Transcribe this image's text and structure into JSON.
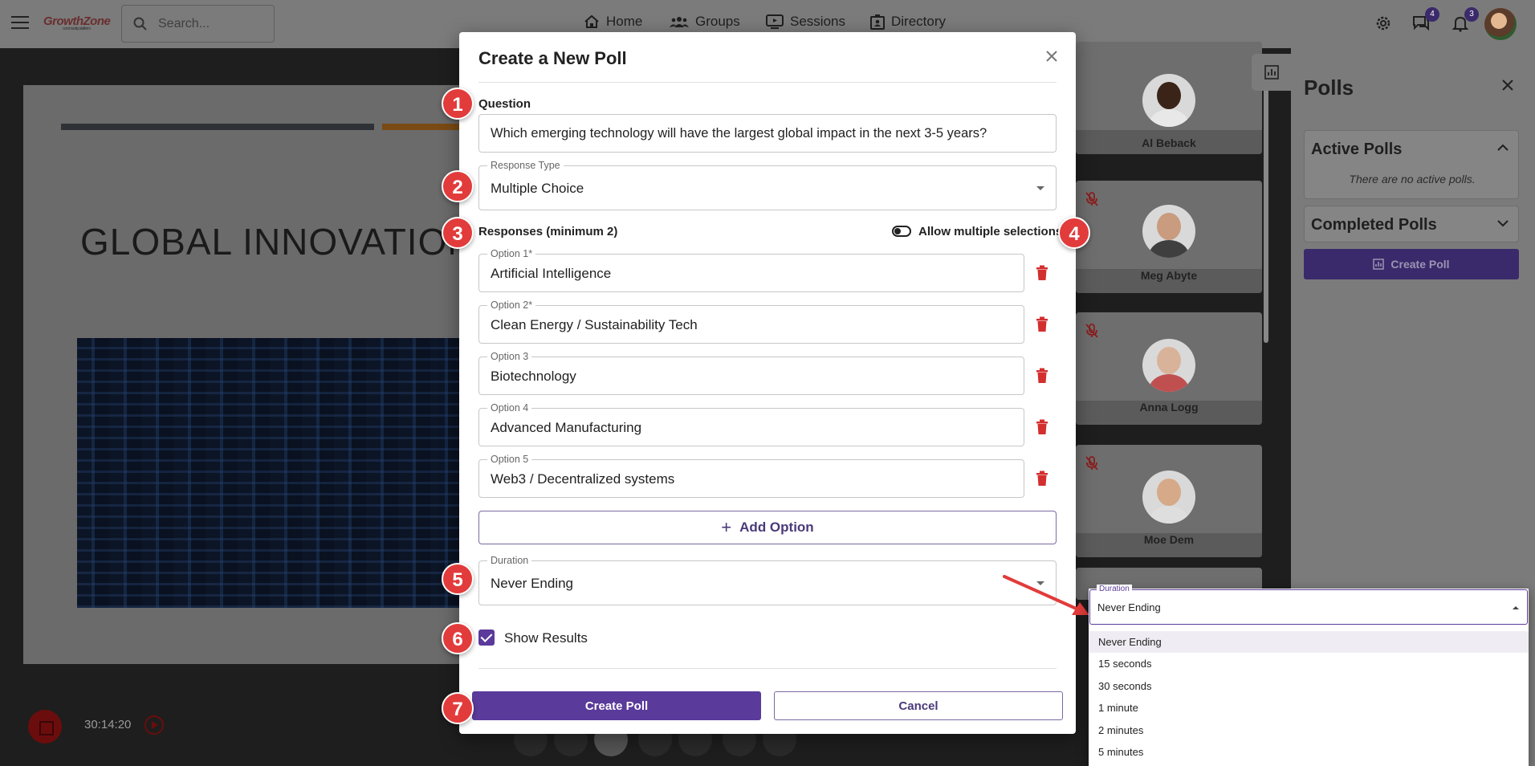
{
  "header": {
    "logo_text": "GrowthZone",
    "logo_tagline": "community platform",
    "search_placeholder": "Search...",
    "nav": [
      {
        "label": "Home"
      },
      {
        "label": "Groups"
      },
      {
        "label": "Sessions"
      },
      {
        "label": "Directory"
      }
    ],
    "chat_badge": "4",
    "notification_badge": "3"
  },
  "slide": {
    "title": "GLOBAL INNOVATION",
    "timer": "30:14:20"
  },
  "participants": [
    {
      "name": "Al Beback"
    },
    {
      "name": "Meg Abyte"
    },
    {
      "name": "Anna Logg"
    },
    {
      "name": "Moe Dem"
    }
  ],
  "polls_panel": {
    "title": "Polls",
    "active_title": "Active Polls",
    "active_empty": "There are no active polls.",
    "completed_title": "Completed Polls",
    "create_label": "Create Poll"
  },
  "modal": {
    "title": "Create a New Poll",
    "question_label": "Question",
    "question_value": "Which emerging technology will have the largest global impact in the next 3-5 years?",
    "response_type_label": "Response Type",
    "response_type_value": "Multiple Choice",
    "responses_label": "Responses (minimum 2)",
    "allow_multiple_label": "Allow multiple selections",
    "options": [
      {
        "label": "Option 1*",
        "value": "Artificial Intelligence"
      },
      {
        "label": "Option 2*",
        "value": "Clean Energy / Sustainability Tech"
      },
      {
        "label": "Option 3",
        "value": "Biotechnology"
      },
      {
        "label": "Option 4",
        "value": "Advanced Manufacturing"
      },
      {
        "label": "Option 5",
        "value": "Web3 / Decentralized systems"
      }
    ],
    "add_option_label": "Add Option",
    "duration_label": "Duration",
    "duration_value": "Never Ending",
    "show_results_label": "Show Results",
    "show_results_checked": true,
    "create_button": "Create Poll",
    "cancel_button": "Cancel"
  },
  "duration_dropdown": {
    "label": "Duration",
    "value": "Never Ending",
    "options": [
      "Never Ending",
      "15 seconds",
      "30 seconds",
      "1 minute",
      "2 minutes",
      "5 minutes"
    ]
  },
  "steps": [
    "1",
    "2",
    "3",
    "4",
    "5",
    "6",
    "7"
  ],
  "colors": {
    "brand_purple": "#5a3a9b",
    "step_red": "#e23b3b",
    "trash_red": "#d32f2f"
  }
}
